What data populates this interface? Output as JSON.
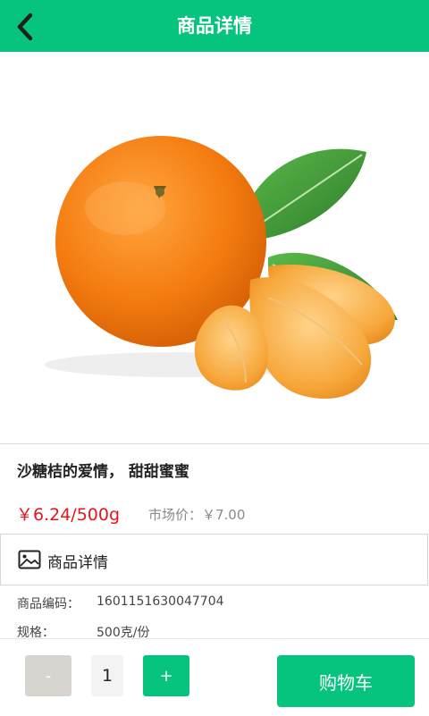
{
  "header": {
    "title": "商品详情",
    "back_icon": "chevron-left-icon"
  },
  "product": {
    "image_icon": "tangerine-image",
    "name": "沙糖桔的爱情， 甜甜蜜蜜",
    "price": "￥6.24/500g",
    "market_price": "市场价：￥7.00"
  },
  "detail": {
    "icon": "image-icon",
    "label": "商品详情"
  },
  "specs": [
    {
      "label": "商品编码：",
      "value": "1601151630047704"
    },
    {
      "label": "规格：",
      "value": "500克/份"
    }
  ],
  "cart": {
    "minus_label": "-",
    "quantity": "1",
    "plus_label": "+",
    "button_label": "购物车"
  },
  "colors": {
    "accent": "#06c47e",
    "price_red": "#e4161b",
    "muted": "#8a8a8a"
  }
}
